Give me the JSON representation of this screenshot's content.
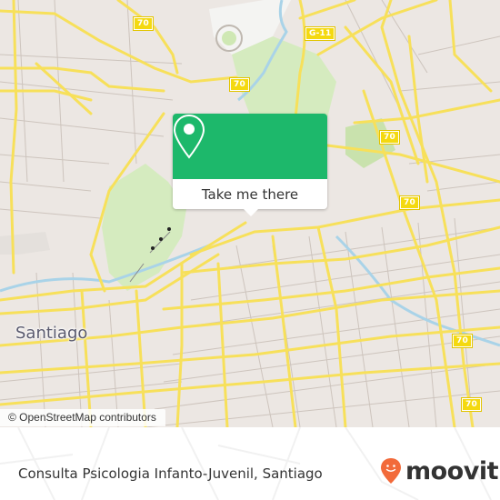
{
  "map": {
    "city_label": "Santiago",
    "attribution": "© OpenStreetMap contributors",
    "route_shields": [
      {
        "label": "70",
        "kind": "highway"
      },
      {
        "label": "70",
        "kind": "highway"
      },
      {
        "label": "G-11",
        "kind": "highway"
      },
      {
        "label": "70",
        "kind": "highway"
      },
      {
        "label": "70",
        "kind": "highway"
      },
      {
        "label": "70",
        "kind": "highway"
      },
      {
        "label": "70",
        "kind": "highway"
      }
    ],
    "colors": {
      "land": "#ece7e3",
      "park": "#cfe8b4",
      "road_major": "#f7e05a",
      "road_minor": "#cfc6c0",
      "water": "#a9d3e8"
    }
  },
  "popup": {
    "icon": "map-pin-icon",
    "button_label": "Take me there",
    "accent_color": "#1db86b"
  },
  "footer": {
    "place_name": "Consulta Psicologia Infanto-Juvenil, Santiago",
    "brand": "moovit",
    "brand_icon": "moovit-smiley-pin-icon",
    "brand_color": "#f26a3a"
  }
}
